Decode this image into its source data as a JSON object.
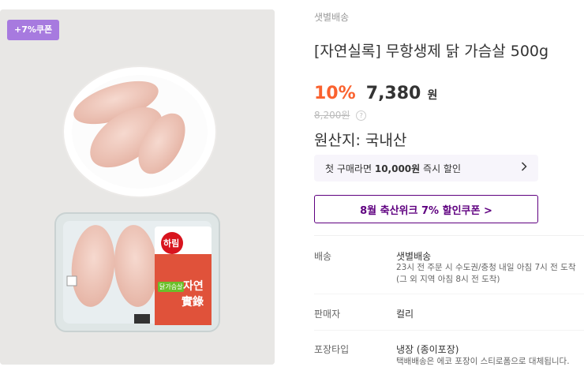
{
  "badge": "+7%쿠폰",
  "product": {
    "delivery_type": "샛별배송",
    "title": "[자연실록] 무항생제 닭 가슴살 500g",
    "discount": "10%",
    "price": "7,380",
    "currency": "원",
    "original_price": "8,200원",
    "origin": "원산지: 국내산"
  },
  "package_label": {
    "brand": "하림",
    "tag": "닭가슴살",
    "name_line1": "자연",
    "name_line2": "實錄"
  },
  "first_order": {
    "prefix": "첫 구매라면",
    "amount": "10,000원",
    "suffix": "즉시 할인"
  },
  "coupon_button": "8월 축산위크 7% 할인쿠폰 >",
  "info": [
    {
      "label": "배송",
      "value": "샛별배송",
      "sub1": "23시 전 주문 시 수도권/충청 내일 아침 7시 전 도착",
      "sub2": "(그 외 지역 아침 8시 전 도착)"
    },
    {
      "label": "판매자",
      "value": "컬리"
    },
    {
      "label": "포장타입",
      "value": "냉장 (종이포장)",
      "sub1": "택배배송은 에코 포장이 스티로폼으로 대체됩니다."
    }
  ],
  "colors": {
    "accent": "#5f0080",
    "discount": "#fa622f",
    "badge": "#a77adf"
  }
}
